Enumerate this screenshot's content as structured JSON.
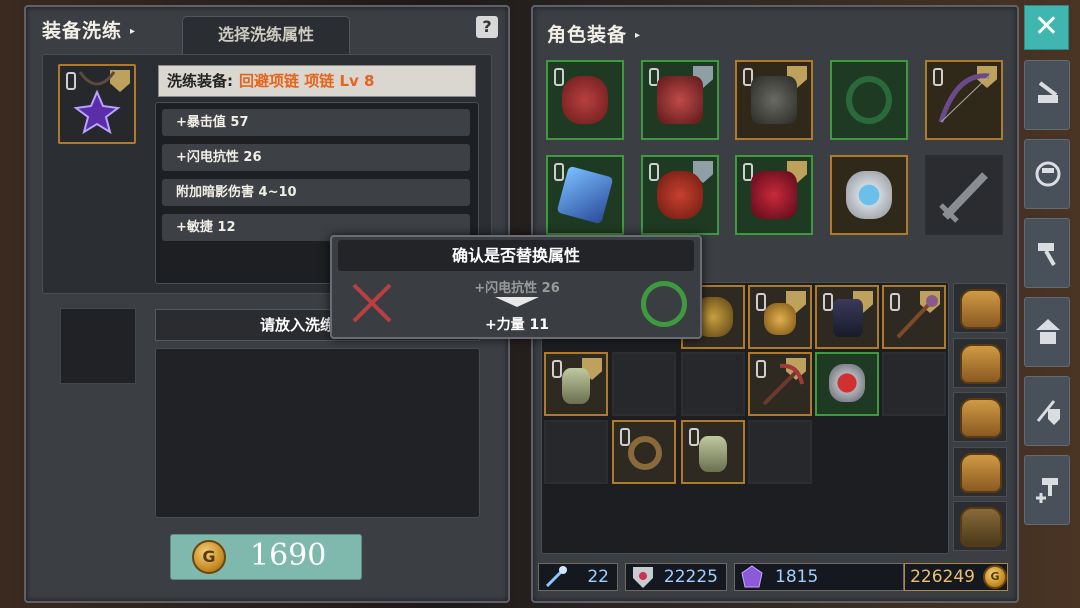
{
  "left_panel": {
    "title": "装备洗练",
    "tab_label": "选择洗练属性",
    "help_icon": "question-icon",
    "equip_header": {
      "label": "洗练装备:",
      "item_name": "回避项链 项链 Lv 8"
    },
    "attributes": [
      "+暴击值 57",
      "+闪电抗性 26",
      "附加暗影伤害 4~10",
      "+敏捷 12"
    ],
    "insert_label": "请放入洗练石",
    "coins": "1690"
  },
  "right_panel": {
    "title": "角色装备"
  },
  "dialog": {
    "title": "确认是否替换属性",
    "old_attr": "+闪电抗性 26",
    "new_attr": "+力量 11",
    "cancel_icon": "x-cross-icon",
    "confirm_icon": "circle-confirm-icon"
  },
  "resources": {
    "wand_count": "22",
    "gem_count": "22225",
    "crystal_count": "1815",
    "gold_count": "226249"
  },
  "colors": {
    "accent_orange": "#e8641c",
    "rare_green": "#3f9a3f",
    "epic_gold": "#b07a2c",
    "close_teal": "#3fb6b0"
  }
}
